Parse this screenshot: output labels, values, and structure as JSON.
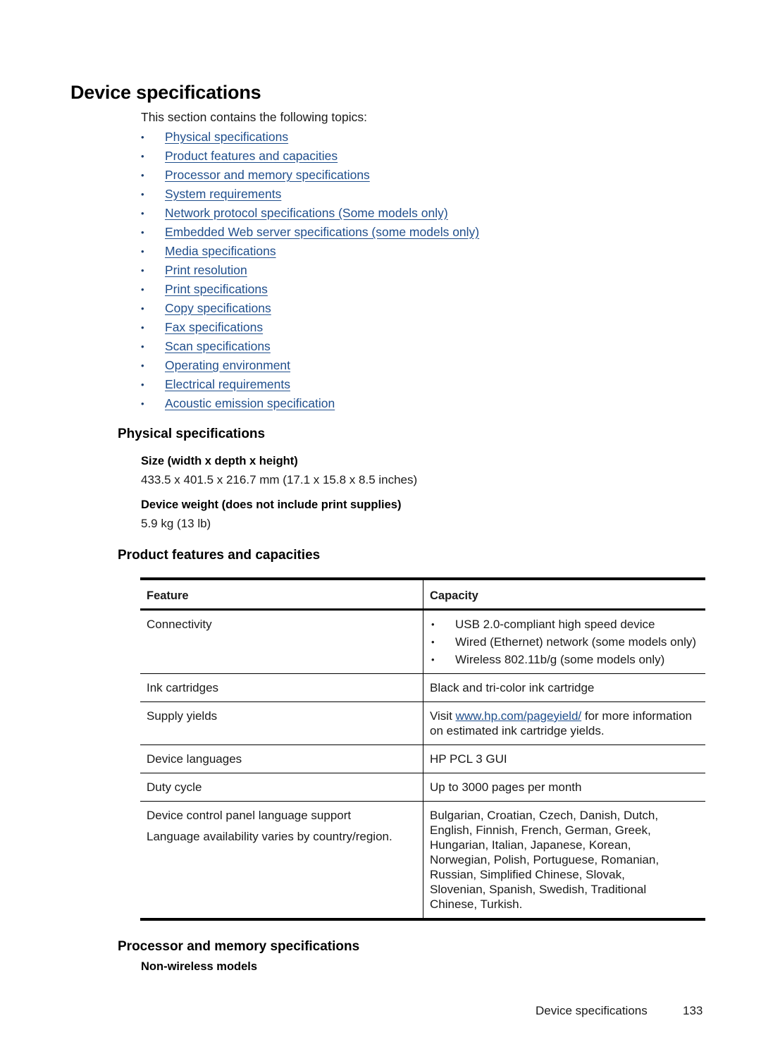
{
  "page": {
    "title": "Device specifications",
    "intro": "This section contains the following topics:",
    "toc": [
      "Physical specifications",
      "Product features and capacities",
      "Processor and memory specifications",
      "System requirements",
      "Network protocol specifications (Some models only)",
      "Embedded Web server specifications (some models only)",
      "Media specifications",
      "Print resolution",
      "Print specifications",
      "Copy specifications",
      "Fax specifications",
      "Scan specifications",
      "Operating environment",
      "Electrical requirements",
      "Acoustic emission specification"
    ],
    "bullet": "•"
  },
  "physical": {
    "heading": "Physical specifications",
    "size_label": "Size (width x depth x height)",
    "size_value": "433.5 x 401.5 x 216.7 mm (17.1 x 15.8 x 8.5 inches)",
    "weight_label": "Device weight (does not include print supplies)",
    "weight_value": "5.9 kg (13 lb)"
  },
  "features": {
    "heading": "Product features and capacities",
    "columns": [
      "Feature",
      "Capacity"
    ],
    "rows": {
      "connectivity": {
        "feature": "Connectivity",
        "items": [
          "USB 2.0-compliant high speed device",
          "Wired (Ethernet) network (some models only)",
          "Wireless 802.11b/g (some models only)"
        ]
      },
      "ink": {
        "feature": "Ink cartridges",
        "capacity": "Black and tri-color ink cartridge"
      },
      "yields": {
        "feature": "Supply yields",
        "prefix": "Visit ",
        "link": "www.hp.com/pageyield/",
        "suffix": " for more information on estimated ink cartridge yields."
      },
      "languages": {
        "feature": "Device languages",
        "capacity": "HP PCL 3 GUI"
      },
      "duty": {
        "feature": "Duty cycle",
        "capacity": "Up to 3000 pages per month"
      },
      "panel": {
        "feature": "Device control panel language support",
        "note": "Language availability varies by country/region.",
        "capacity": "Bulgarian, Croatian, Czech, Danish, Dutch, English, Finnish, French, German, Greek, Hungarian, Italian, Japanese, Korean, Norwegian, Polish, Portuguese, Romanian, Russian, Simplified Chinese, Slovak, Slovenian, Spanish, Swedish, Traditional Chinese, Turkish."
      }
    }
  },
  "processor": {
    "heading": "Processor and memory specifications",
    "subheading": "Non-wireless models"
  },
  "footer": {
    "section": "Device specifications",
    "page_number": "133"
  }
}
